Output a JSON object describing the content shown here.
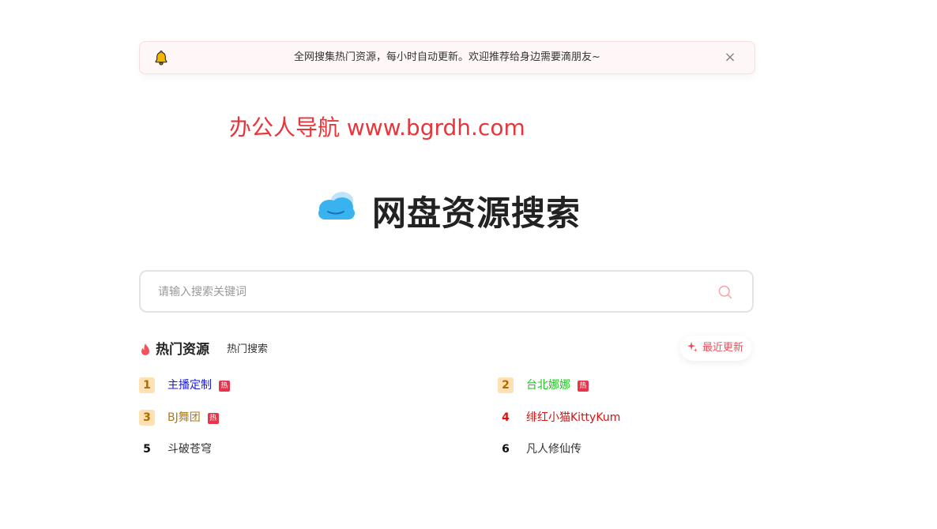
{
  "notice": {
    "text": "全网搜集热门资源，每小时自动更新。欢迎推荐给身边需要滴朋友~",
    "close_label": "×"
  },
  "site_title": "办公人导航 www.bgrdh.com",
  "hero": {
    "title": "网盘资源搜索"
  },
  "search": {
    "placeholder": "请输入搜索关键词",
    "value": ""
  },
  "hot": {
    "title": "热门资源",
    "tab_label": "热门搜索",
    "recent_label": "最近更新",
    "badge_text": "热",
    "items": [
      {
        "rank": "1",
        "label": "主播定制",
        "hot": true,
        "color": "#1a1adf"
      },
      {
        "rank": "2",
        "label": "台北娜娜",
        "hot": true,
        "color": "#22c122"
      },
      {
        "rank": "3",
        "label": "BJ舞团",
        "hot": true,
        "color": "#b07a1a"
      },
      {
        "rank": "4",
        "label": "绯红小猫KittyKum",
        "hot": false,
        "color": "#cc1515"
      },
      {
        "rank": "5",
        "label": "斗破苍穹",
        "hot": false,
        "color": "#333333"
      },
      {
        "rank": "6",
        "label": "凡人修仙传",
        "hot": false,
        "color": "#333333"
      }
    ]
  },
  "colors": {
    "accent": "#e8353b",
    "badge": "#e8334a",
    "rank_bg": "#fde1b3"
  },
  "icons": {
    "notice": "bell-icon",
    "close": "close-icon",
    "logo": "cloud-icon",
    "search": "search-icon",
    "hot": "fire-icon",
    "recent": "sparkle-icon"
  }
}
